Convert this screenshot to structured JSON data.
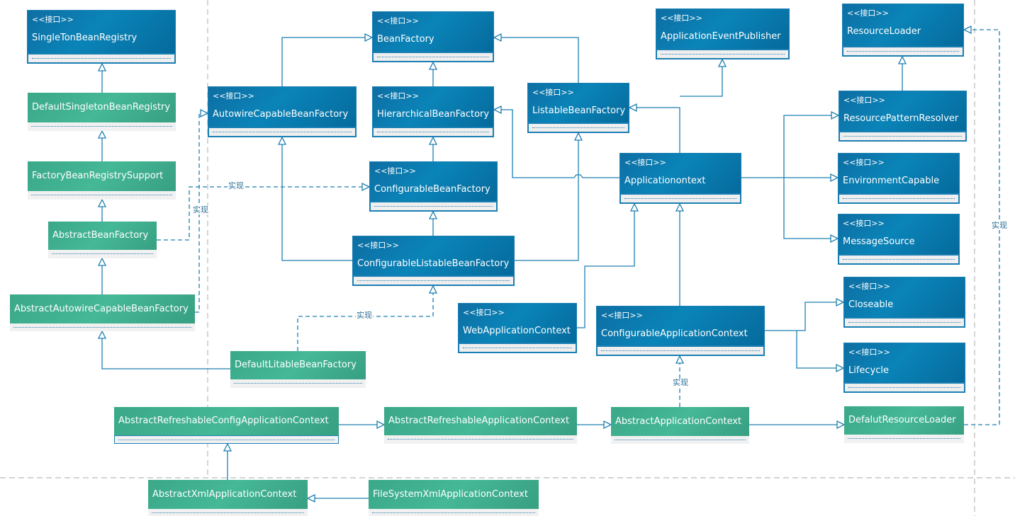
{
  "diagram": {
    "stereotype": "<<接口>>",
    "impl_label": "实现",
    "colors": {
      "interface": "#0a7db3",
      "class": "#40b190",
      "line": "#1e7fb0",
      "separator": "#bbbbbb"
    },
    "interfaces": [
      {
        "id": "singleton_bean_registry",
        "name": "SingleTonBeanRegistry"
      },
      {
        "id": "bean_factory",
        "name": "BeanFactory"
      },
      {
        "id": "autowire_capable_bean_factory",
        "name": "AutowireCapableBeanFactory"
      },
      {
        "id": "hierarchical_bean_factory",
        "name": "HierarchicalBeanFactory"
      },
      {
        "id": "listable_bean_factory",
        "name": "ListableBeanFactory"
      },
      {
        "id": "configurable_bean_factory",
        "name": "ConfigurableBeanFactory"
      },
      {
        "id": "configurable_listable_bean_factory",
        "name": "ConfigurableListableBeanFactory"
      },
      {
        "id": "application_event_publisher",
        "name": "ApplicationEventPublisher"
      },
      {
        "id": "resource_loader",
        "name": "ResourceLoader"
      },
      {
        "id": "resource_pattern_resolver",
        "name": "ResourcePatternResolver"
      },
      {
        "id": "environment_capable",
        "name": "EnvironmentCapable"
      },
      {
        "id": "message_source",
        "name": "MessageSource"
      },
      {
        "id": "application_context",
        "name": "Applicationontext"
      },
      {
        "id": "web_application_context",
        "name": "WebApplicationContext"
      },
      {
        "id": "configurable_application_context",
        "name": "ConfigurableApplicationContext"
      },
      {
        "id": "closeable",
        "name": "Closeable"
      },
      {
        "id": "lifecycle",
        "name": "Lifecycle"
      }
    ],
    "classes": [
      {
        "id": "default_singleton_bean_registry",
        "name": "DefaultSingletonBeanRegistry"
      },
      {
        "id": "factory_bean_registry_support",
        "name": "FactoryBeanRegistrySupport"
      },
      {
        "id": "abstract_bean_factory",
        "name": "AbstractBeanFactory"
      },
      {
        "id": "abstract_autowire_capable_bean_factory",
        "name": "AbstractAutowireCapableBeanFactory"
      },
      {
        "id": "default_listable_bean_factory",
        "name": "DefaultLitableBeanFactory"
      },
      {
        "id": "abstract_refreshable_config_application_context",
        "name": "AbstractRefreshableConfigApplicationContext"
      },
      {
        "id": "abstract_refreshable_application_context",
        "name": "AbstractRefreshableApplicationContext"
      },
      {
        "id": "abstract_application_context",
        "name": "AbstractApplicationContext"
      },
      {
        "id": "default_resource_loader",
        "name": "DefalutResourceLoader"
      },
      {
        "id": "abstract_xml_application_context",
        "name": "AbstractXmlApplicationContext"
      },
      {
        "id": "file_system_xml_application_context",
        "name": "FileSystemXmlApplicationContext"
      }
    ],
    "relations": [
      {
        "from": "default_singleton_bean_registry",
        "to": "singleton_bean_registry",
        "type": "generalization"
      },
      {
        "from": "factory_bean_registry_support",
        "to": "default_singleton_bean_registry",
        "type": "generalization"
      },
      {
        "from": "abstract_bean_factory",
        "to": "factory_bean_registry_support",
        "type": "generalization"
      },
      {
        "from": "abstract_autowire_capable_bean_factory",
        "to": "abstract_bean_factory",
        "type": "generalization"
      },
      {
        "from": "default_listable_bean_factory",
        "to": "abstract_autowire_capable_bean_factory",
        "type": "generalization"
      },
      {
        "from": "abstract_bean_factory",
        "to": "configurable_bean_factory",
        "type": "realization",
        "label": "实现"
      },
      {
        "from": "abstract_autowire_capable_bean_factory",
        "to": "autowire_capable_bean_factory",
        "type": "realization",
        "label": "实现"
      },
      {
        "from": "default_listable_bean_factory",
        "to": "configurable_listable_bean_factory",
        "type": "realization",
        "label": "实现"
      },
      {
        "from": "autowire_capable_bean_factory",
        "to": "bean_factory",
        "type": "generalization"
      },
      {
        "from": "hierarchical_bean_factory",
        "to": "bean_factory",
        "type": "generalization"
      },
      {
        "from": "listable_bean_factory",
        "to": "bean_factory",
        "type": "generalization"
      },
      {
        "from": "configurable_bean_factory",
        "to": "hierarchical_bean_factory",
        "type": "generalization"
      },
      {
        "from": "configurable_listable_bean_factory",
        "to": "configurable_bean_factory",
        "type": "generalization"
      },
      {
        "from": "configurable_listable_bean_factory",
        "to": "autowire_capable_bean_factory",
        "type": "generalization"
      },
      {
        "from": "configurable_listable_bean_factory",
        "to": "listable_bean_factory",
        "type": "generalization"
      },
      {
        "from": "application_context",
        "to": "listable_bean_factory",
        "type": "generalization"
      },
      {
        "from": "application_context",
        "to": "hierarchical_bean_factory",
        "type": "generalization"
      },
      {
        "from": "application_context",
        "to": "application_event_publisher",
        "type": "generalization"
      },
      {
        "from": "application_context",
        "to": "resource_pattern_resolver",
        "type": "generalization"
      },
      {
        "from": "application_context",
        "to": "environment_capable",
        "type": "generalization"
      },
      {
        "from": "application_context",
        "to": "message_source",
        "type": "generalization"
      },
      {
        "from": "resource_pattern_resolver",
        "to": "resource_loader",
        "type": "generalization"
      },
      {
        "from": "web_application_context",
        "to": "application_context",
        "type": "generalization"
      },
      {
        "from": "configurable_application_context",
        "to": "application_context",
        "type": "generalization"
      },
      {
        "from": "configurable_application_context",
        "to": "closeable",
        "type": "generalization"
      },
      {
        "from": "configurable_application_context",
        "to": "lifecycle",
        "type": "generalization"
      },
      {
        "from": "abstract_application_context",
        "to": "configurable_application_context",
        "type": "realization",
        "label": "实现"
      },
      {
        "from": "abstract_application_context",
        "to": "default_resource_loader",
        "type": "generalization"
      },
      {
        "from": "default_resource_loader",
        "to": "resource_loader",
        "type": "realization",
        "label": "实现"
      },
      {
        "from": "abstract_refreshable_application_context",
        "to": "abstract_application_context",
        "type": "generalization"
      },
      {
        "from": "abstract_refreshable_config_application_context",
        "to": "abstract_refreshable_application_context",
        "type": "generalization"
      },
      {
        "from": "abstract_xml_application_context",
        "to": "abstract_refreshable_config_application_context",
        "type": "generalization"
      },
      {
        "from": "file_system_xml_application_context",
        "to": "abstract_xml_application_context",
        "type": "generalization"
      }
    ]
  }
}
